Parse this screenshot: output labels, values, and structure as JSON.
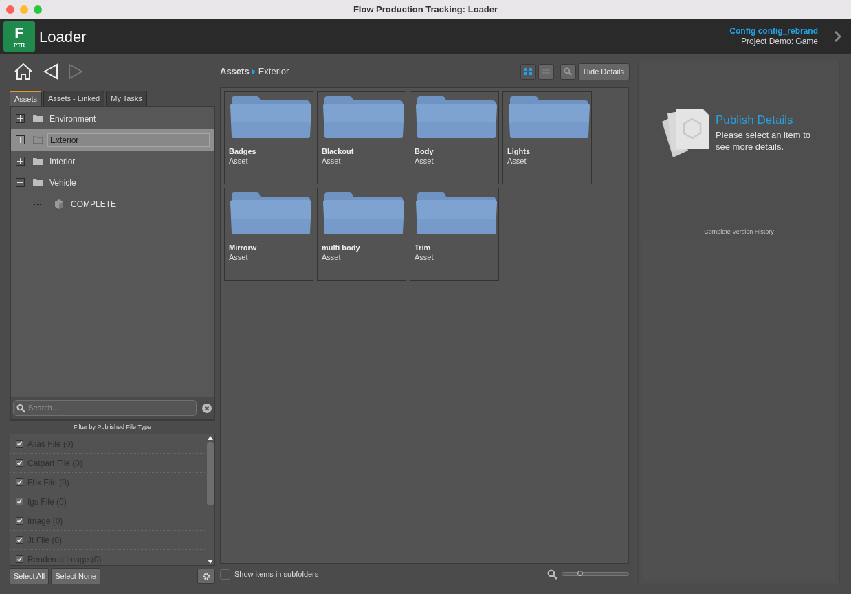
{
  "window": {
    "title": "Flow Production Tracking: Loader"
  },
  "header": {
    "logo_letter": "F",
    "logo_badge": "PTR",
    "app_name": "Loader",
    "config": "Config config_rebrand",
    "project": "Project Demo: Game"
  },
  "tabs": [
    {
      "label": "Assets",
      "selected": true
    },
    {
      "label": "Assets - Linked",
      "selected": false
    },
    {
      "label": "My Tasks",
      "selected": false
    }
  ],
  "tree": [
    {
      "label": "Environment",
      "kind": "folder",
      "expanded": false,
      "selected": false
    },
    {
      "label": "Exterior",
      "kind": "folder",
      "expanded": false,
      "selected": true
    },
    {
      "label": "Interior",
      "kind": "folder",
      "expanded": false,
      "selected": false
    },
    {
      "label": "Vehicle",
      "kind": "folder",
      "expanded": true,
      "selected": false,
      "children": [
        {
          "label": "COMPLETE",
          "kind": "entity",
          "selected": false
        }
      ]
    }
  ],
  "search": {
    "placeholder": "Search..."
  },
  "filter": {
    "title": "Filter by Published File Type",
    "items": [
      {
        "label": "Alias File (0)",
        "checked": true
      },
      {
        "label": "Catpart File (0)",
        "checked": true
      },
      {
        "label": "Fbx File (0)",
        "checked": true
      },
      {
        "label": "Igs File (0)",
        "checked": true
      },
      {
        "label": "Image (0)",
        "checked": true
      },
      {
        "label": "Jt File (0)",
        "checked": true
      },
      {
        "label": "Rendered Image (0)",
        "checked": true
      }
    ],
    "buttons": [
      "Select All",
      "Select None"
    ]
  },
  "breadcrumb": [
    "Assets",
    "Exterior"
  ],
  "view_modes": [
    {
      "kind": "grid",
      "selected": true
    },
    {
      "kind": "list",
      "selected": false
    }
  ],
  "hide_details": "Hide Details",
  "assets": [
    {
      "name": "Badges",
      "type": "Asset"
    },
    {
      "name": "Blackout",
      "type": "Asset"
    },
    {
      "name": "Body",
      "type": "Asset"
    },
    {
      "name": "Lights",
      "type": "Asset"
    },
    {
      "name": "Mirrorw",
      "type": "Asset"
    },
    {
      "name": "multi body",
      "type": "Asset"
    },
    {
      "name": "Trim",
      "type": "Asset"
    }
  ],
  "subfolders": {
    "label": "Show items in subfolders",
    "checked": false
  },
  "zoom": {
    "level": 0.27
  },
  "details": {
    "title": "Publish Details",
    "message": "Please select an item to see more details.",
    "history_title": "Complete Version History"
  }
}
